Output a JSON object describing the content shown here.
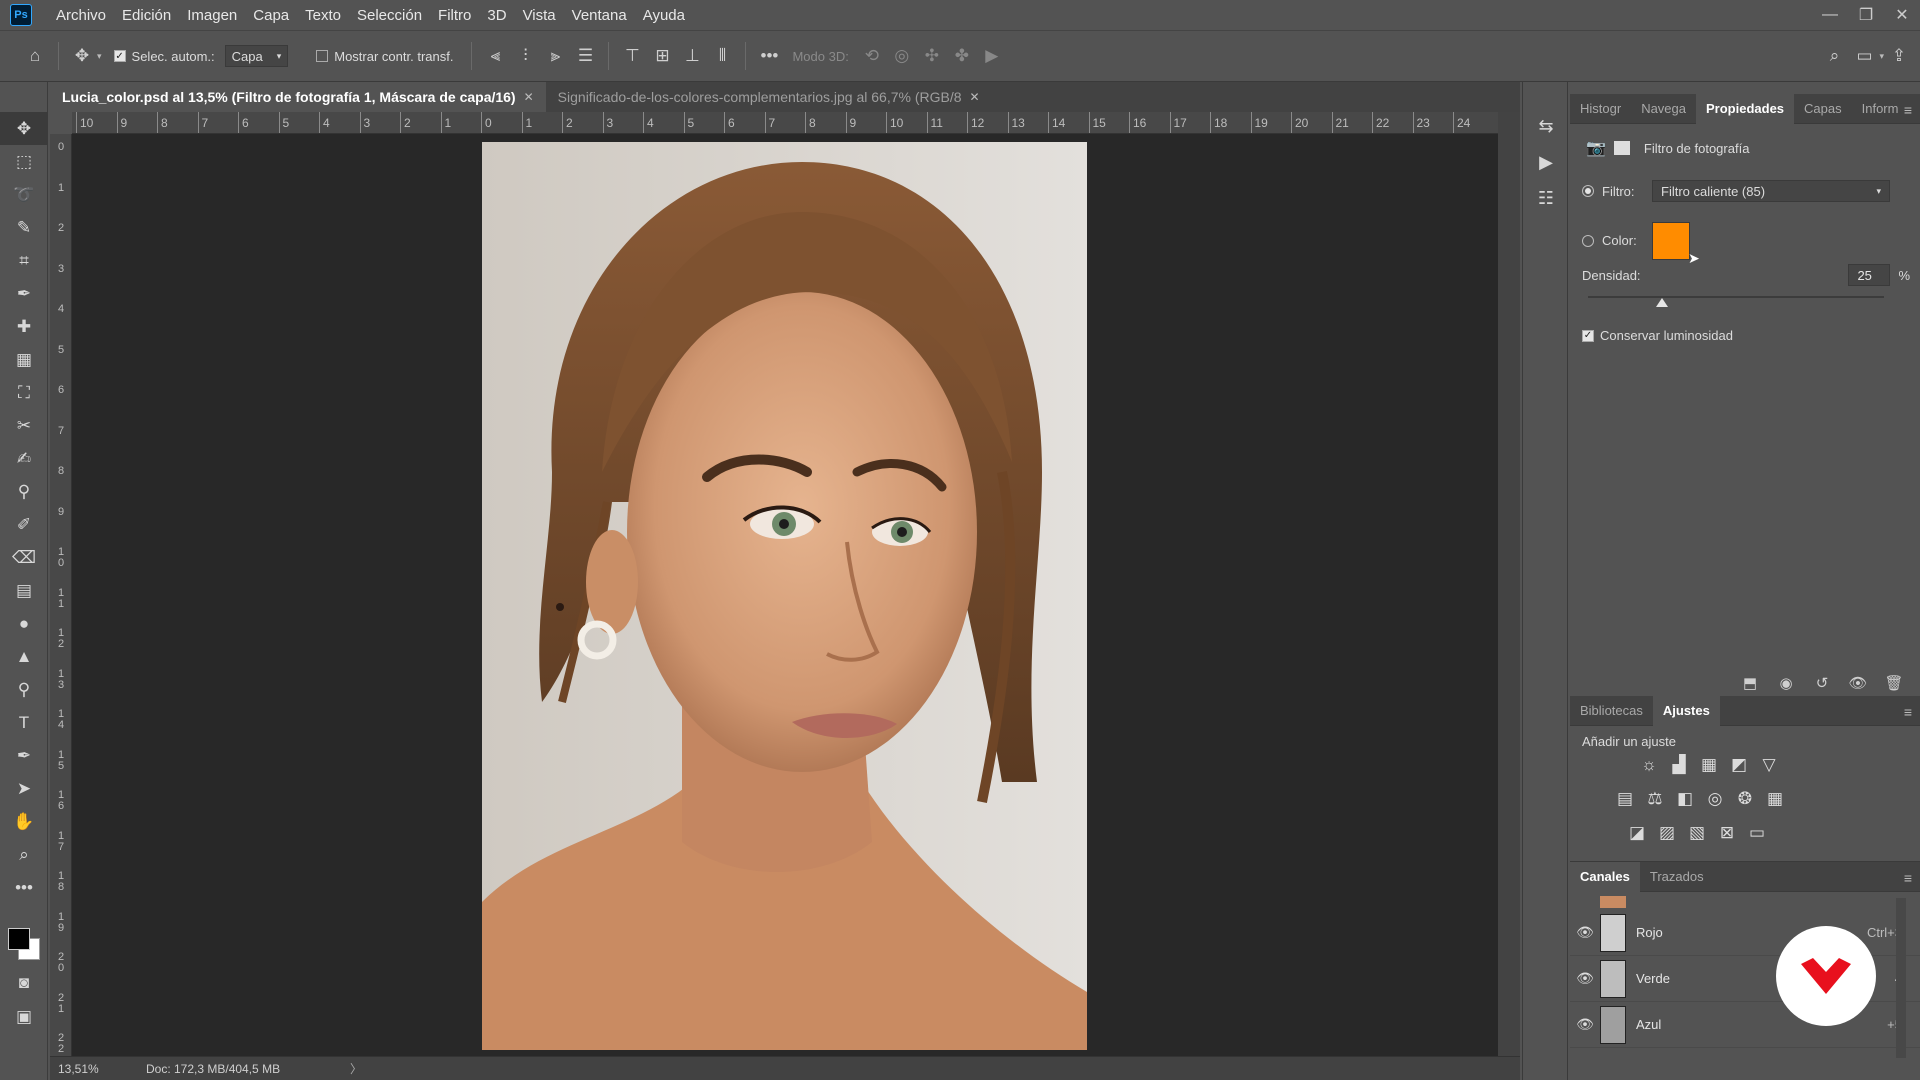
{
  "app": {
    "logo": "Ps"
  },
  "menu": [
    "Archivo",
    "Edición",
    "Imagen",
    "Capa",
    "Texto",
    "Selección",
    "Filtro",
    "3D",
    "Vista",
    "Ventana",
    "Ayuda"
  ],
  "window_controls": {
    "minimize": "—",
    "restore": "❐",
    "close": "✕"
  },
  "options_bar": {
    "auto_select_label": "Selec. autom.:",
    "auto_select_checked": true,
    "auto_select_target": "Capa",
    "show_transform_label": "Mostrar contr. transf.",
    "show_transform_checked": false,
    "mode3d_label": "Modo 3D:",
    "more": "•••"
  },
  "tabs": [
    {
      "label": "Lucia_color.psd al 13,5% (Filtro de fotografía 1, Máscara de capa/16)",
      "close": "✕",
      "active": true
    },
    {
      "label": "Significado-de-los-colores-complementarios.jpg al 66,7% (RGB/8",
      "close": "✕",
      "active": false
    }
  ],
  "ruler_top": [
    "10",
    "9",
    "8",
    "7",
    "6",
    "5",
    "4",
    "3",
    "2",
    "1",
    "0",
    "1",
    "2",
    "3",
    "4",
    "5",
    "6",
    "7",
    "8",
    "9",
    "10",
    "11",
    "12",
    "13",
    "14",
    "15",
    "16",
    "17",
    "18",
    "19",
    "20",
    "21",
    "22",
    "23",
    "24"
  ],
  "ruler_left": [
    "0",
    "1",
    "2",
    "3",
    "4",
    "5",
    "6",
    "7",
    "8",
    "9",
    "1\n0",
    "1\n1",
    "1\n2",
    "1\n3",
    "1\n4",
    "1\n5",
    "1\n6",
    "1\n7",
    "1\n8",
    "1\n9",
    "2\n0",
    "2\n1",
    "2\n2"
  ],
  "status": {
    "zoom": "13,51%",
    "doc": "Doc: 172,3 MB/404,5 MB",
    "arrow": "〉"
  },
  "properties_panel": {
    "tabs": [
      "Histogr",
      "Navega",
      "Propiedades",
      "Capas",
      "Inform"
    ],
    "active_tab": "Propiedades",
    "header": "Filtro de fotografía",
    "filter_label": "Filtro:",
    "filter_value": "Filtro caliente (85)",
    "color_label": "Color:",
    "color_swatch": "#ff8c00",
    "density_label": "Densidad:",
    "density_value": "25",
    "density_unit": "%",
    "density_fraction": 0.25,
    "preserve_label": "Conservar luminosidad",
    "preserve_checked": true
  },
  "adjustments_panel": {
    "tabs": [
      "Bibliotecas",
      "Ajustes"
    ],
    "active_tab": "Ajustes",
    "add_label": "Añadir un ajuste"
  },
  "channels_panel": {
    "tabs": [
      "Canales",
      "Trazados"
    ],
    "active_tab": "Canales",
    "channels": [
      {
        "name": "Rojo",
        "shortcut": "Ctrl+3"
      },
      {
        "name": "Verde",
        "shortcut": "4"
      },
      {
        "name": "Azul",
        "shortcut": "+5"
      }
    ]
  },
  "accent_colors": {
    "ps_blue": "#31a8ff",
    "watermark_red": "#e8101d"
  }
}
